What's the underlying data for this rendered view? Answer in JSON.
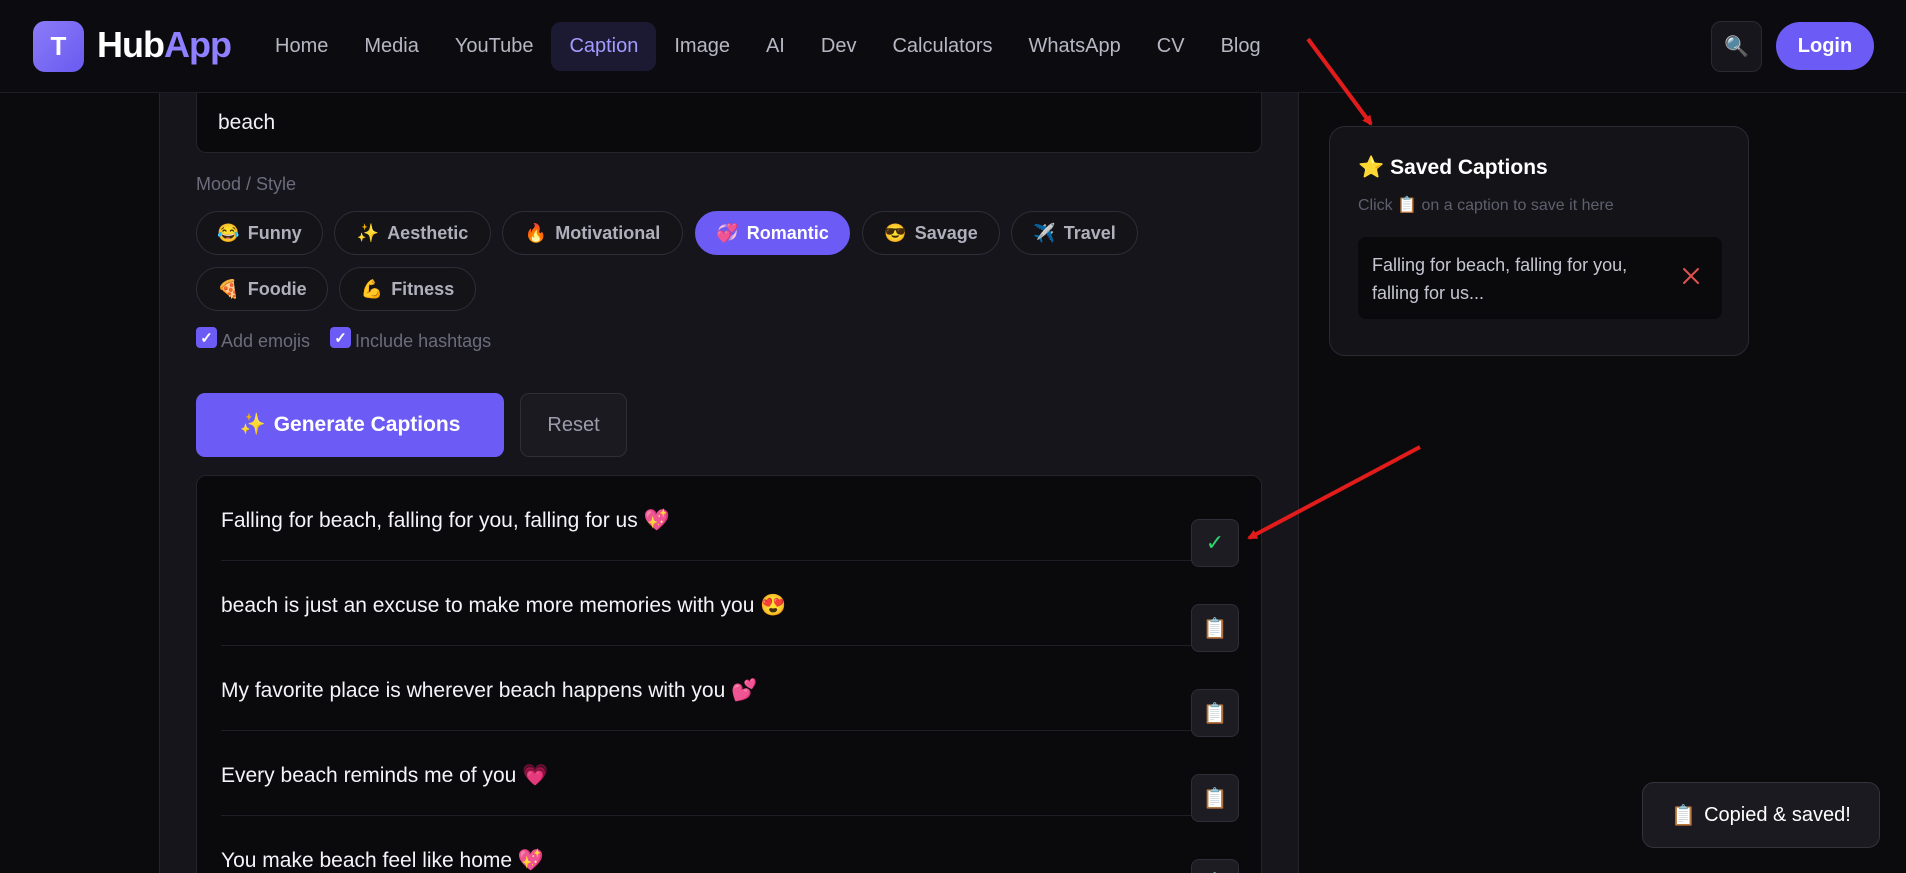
{
  "header": {
    "logo_letter": "T",
    "brand_hub": "Hub",
    "brand_app": "App",
    "nav": [
      "Home",
      "Media",
      "YouTube",
      "Caption",
      "Image",
      "AI",
      "Dev",
      "Calculators",
      "WhatsApp",
      "CV",
      "Blog"
    ],
    "active_nav": "Caption",
    "search_icon": "🔍",
    "login_label": "Login"
  },
  "form": {
    "topic_value": "beach",
    "mood_label": "Mood / Style",
    "moods": [
      {
        "icon": "😂",
        "label": "Funny"
      },
      {
        "icon": "✨",
        "label": "Aesthetic"
      },
      {
        "icon": "🔥",
        "label": "Motivational"
      },
      {
        "icon": "💞",
        "label": "Romantic"
      },
      {
        "icon": "😎",
        "label": "Savage"
      },
      {
        "icon": "✈️",
        "label": "Travel"
      },
      {
        "icon": "🍕",
        "label": "Foodie"
      },
      {
        "icon": "💪",
        "label": "Fitness"
      }
    ],
    "active_mood": "Romantic",
    "add_emojis_label": "Add emojis",
    "include_hashtags_label": "Include hashtags",
    "generate_icon": "✨",
    "generate_label": "Generate Captions",
    "reset_label": "Reset"
  },
  "results": [
    {
      "text": "Falling for beach, falling for you, falling for us 💖",
      "action_icon": "✓",
      "copied": true
    },
    {
      "text": "beach is just an excuse to make more memories with you 😍",
      "action_icon": "📋",
      "copied": false
    },
    {
      "text": "My favorite place is wherever beach happens with you 💕",
      "action_icon": "📋",
      "copied": false
    },
    {
      "text": "Every beach reminds me of you 💗",
      "action_icon": "📋",
      "copied": false
    },
    {
      "text": "You make beach feel like home 💖",
      "action_icon": "📋",
      "copied": false
    }
  ],
  "saved": {
    "star_icon": "⭐",
    "title": "Saved Captions",
    "hint": "Click 📋 on a caption to save it here",
    "items": [
      "Falling for beach, falling for you, falling for us..."
    ]
  },
  "toast": {
    "icon": "📋",
    "text": "Copied & saved!"
  },
  "colors": {
    "accent": "#6c5cf5",
    "background": "#0b0b0e",
    "annotation_red": "#e21b1b",
    "success_green": "#2fd46e"
  }
}
